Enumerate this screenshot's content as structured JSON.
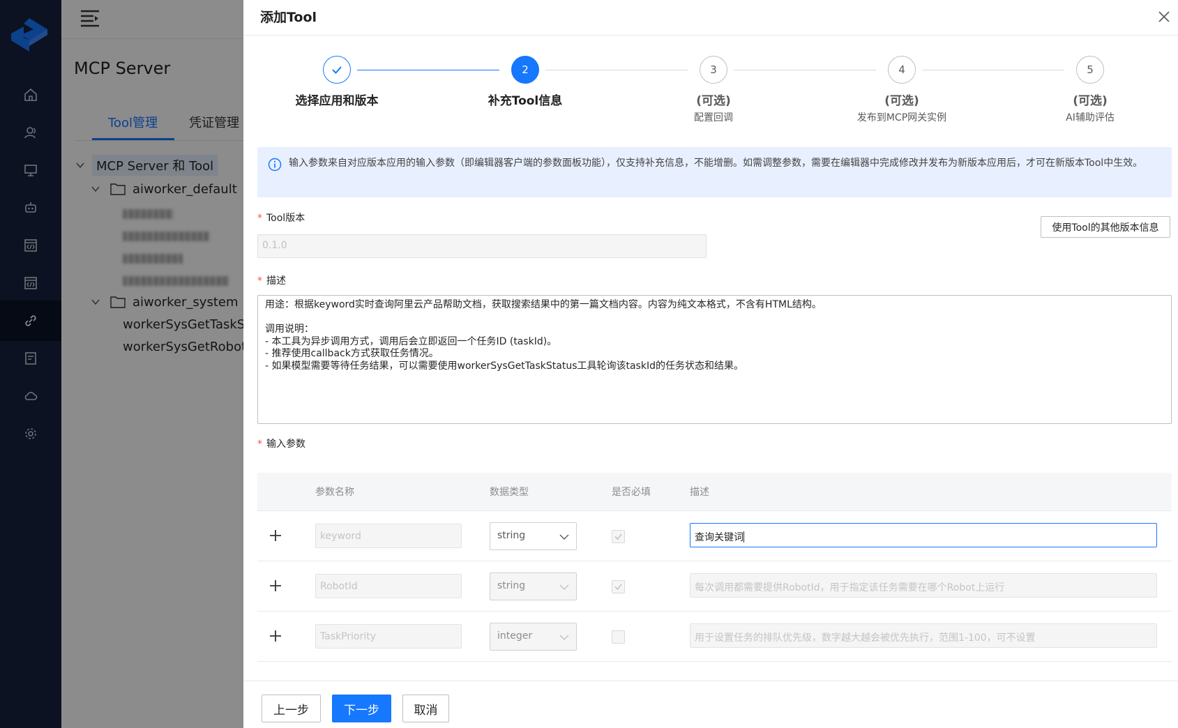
{
  "page": {
    "title": "MCP Server",
    "tabs": [
      {
        "label": "Tool管理"
      },
      {
        "label": "凭证管理"
      }
    ],
    "tree": {
      "root": "MCP Server 和 Tool",
      "folders": [
        {
          "label": "aiworker_default"
        },
        {
          "label": "aiworker_system",
          "items": [
            "workerSysGetTaskSta",
            "workerSysGetRobotW"
          ]
        }
      ]
    }
  },
  "drawer": {
    "title": "添加Tool",
    "steps": [
      {
        "number": "1",
        "title": "选择应用和版本",
        "desc": ""
      },
      {
        "number": "2",
        "title": "补充Tool信息",
        "desc": ""
      },
      {
        "number": "3",
        "title": "(可选)",
        "desc": "配置回调"
      },
      {
        "number": "4",
        "title": "(可选)",
        "desc": "发布到MCP网关实例"
      },
      {
        "number": "5",
        "title": "(可选)",
        "desc": "AI辅助评估"
      }
    ],
    "info_text": "输入参数来自对应版本应用的输入参数（即编辑器客户端的参数面板功能），仅支持补充信息，不能增删。如需调整参数，需要在编辑器中完成修改并发布为新版本应用后，才可在新版本Tool中生效。",
    "version": {
      "label": "Tool版本",
      "value": "0.1.0",
      "other_button": "使用Tool的其他版本信息"
    },
    "description": {
      "label": "描述",
      "value": "用途：根据keyword实时查询阿里云产品帮助文档，获取搜索结果中的第一篇文档内容。内容为纯文本格式，不含有HTML结构。\n\n调用说明：\n- 本工具为异步调用方式，调用后会立即返回一个任务ID (taskId)。\n- 推荐使用callback方式获取任务情况。\n- 如果模型需要等待任务结果，可以需要使用workerSysGetTaskStatus工具轮询该taskId的任务状态和结果。"
    },
    "params": {
      "label": "输入参数",
      "headers": {
        "name": "参数名称",
        "type": "数据类型",
        "required": "是否必填",
        "desc": "描述"
      },
      "rows": [
        {
          "name": "keyword",
          "type": "string",
          "required": true,
          "desc": "查询关键词"
        },
        {
          "name": "RobotId",
          "type": "string",
          "required": true,
          "desc": "每次调用都需要提供RobotId，用于指定该任务需要在哪个Robot上运行"
        },
        {
          "name": "TaskPriority",
          "type": "integer",
          "required": false,
          "desc": "用于设置任务的排队优先级，数字越大越会被优先执行，范围1-100，可不设置"
        }
      ]
    },
    "footer": {
      "prev": "上一步",
      "next": "下一步",
      "cancel": "取消"
    }
  }
}
